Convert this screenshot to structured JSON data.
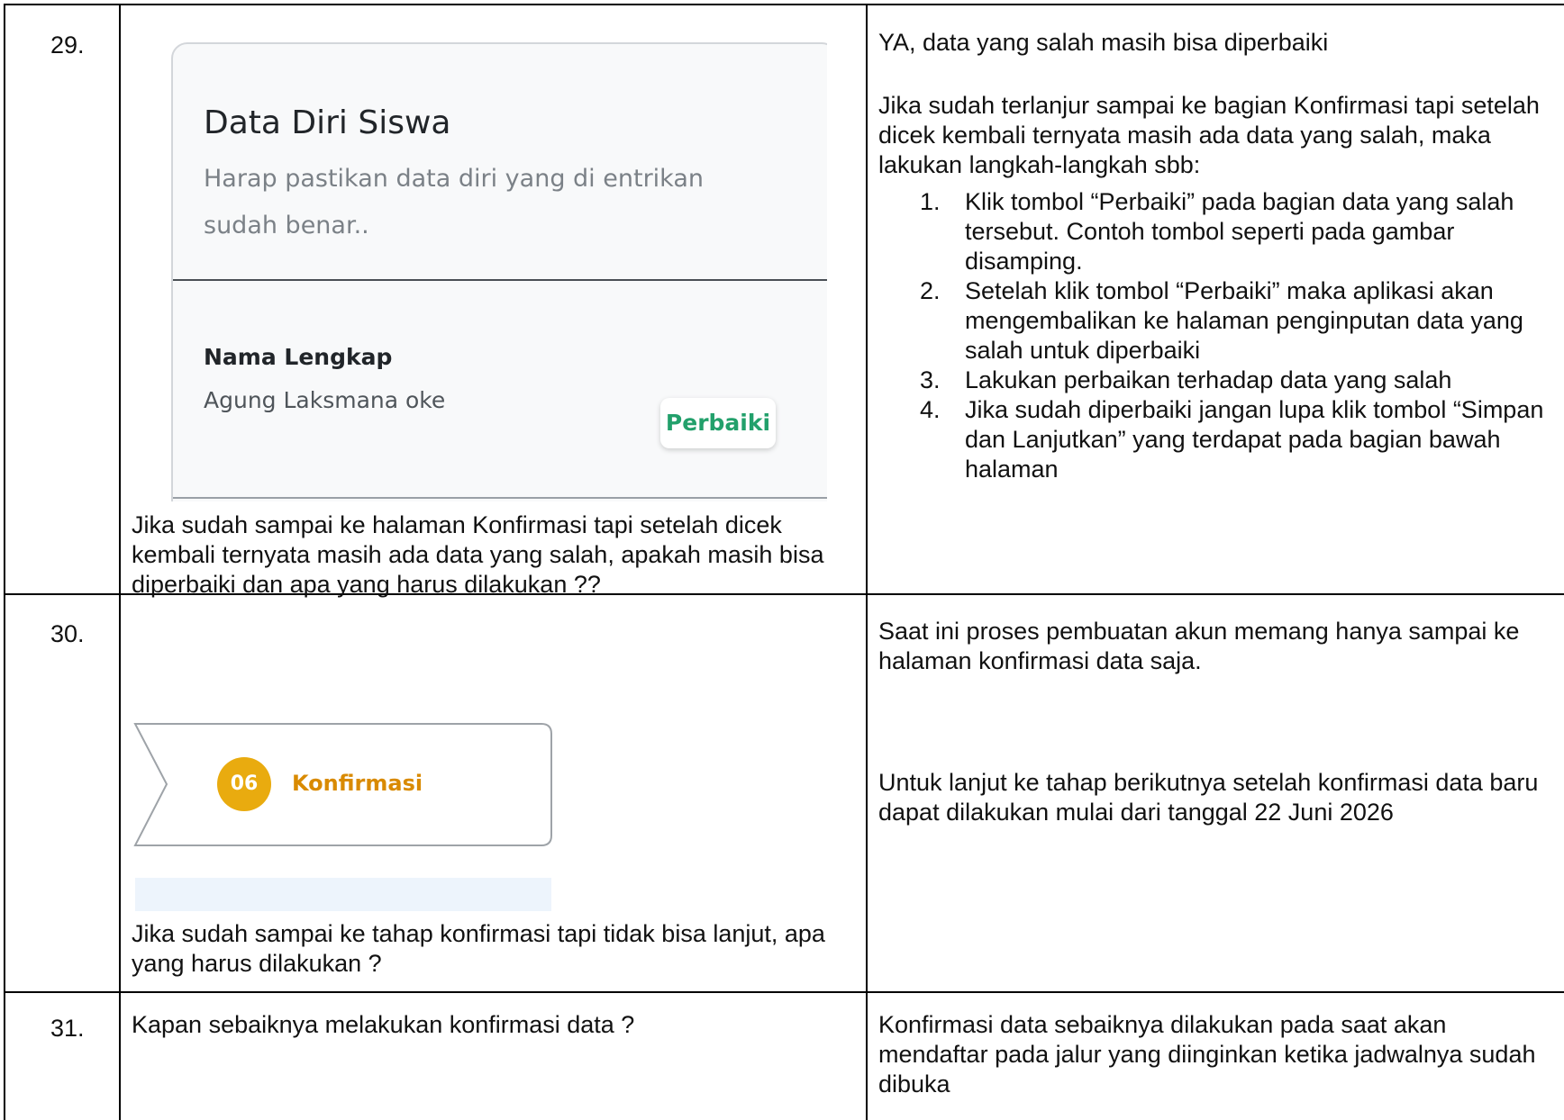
{
  "rows": [
    {
      "number": "29.",
      "screenshot": {
        "card_title": "Data Diri Siswa",
        "card_subtitle": "Harap pastikan data diri yang di entrikan sudah benar..",
        "field_label": "Nama Lengkap",
        "field_value": "Agung Laksmana oke",
        "fix_button": "Perbaiki"
      },
      "question": "Jika sudah sampai ke halaman Konfirmasi tapi setelah dicek kembali ternyata masih ada data yang salah, apakah masih bisa diperbaiki dan apa yang harus dilakukan ??",
      "answer_title": "YA, data yang salah masih bisa diperbaiki",
      "answer_intro": "Jika sudah terlanjur sampai ke bagian Konfirmasi tapi setelah dicek kembali ternyata masih ada data yang salah, maka lakukan langkah-langkah sbb:",
      "steps": [
        {
          "n": "1.",
          "text": "Klik tombol “Perbaiki” pada bagian data yang salah tersebut. Contoh tombol seperti pada gambar disamping."
        },
        {
          "n": "2.",
          "text": "Setelah klik tombol “Perbaiki” maka aplikasi akan mengembalikan ke halaman penginputan data yang salah untuk diperbaiki"
        },
        {
          "n": "3.",
          "text": "Lakukan perbaikan terhadap data yang salah"
        },
        {
          "n": "4.",
          "text": "Jika sudah diperbaiki jangan lupa klik tombol “Simpan dan Lanjutkan” yang terdapat pada bagian bawah halaman"
        }
      ]
    },
    {
      "number": "30.",
      "screenshot": {
        "step_number": "06",
        "step_label": "Konfirmasi"
      },
      "question": "Jika sudah sampai ke tahap konfirmasi tapi tidak bisa lanjut, apa yang harus dilakukan ?",
      "answer_p1": "Saat ini proses pembuatan akun memang hanya sampai ke halaman konfirmasi data saja.",
      "answer_p2": "Untuk lanjut ke tahap berikutnya setelah konfirmasi data baru dapat dilakukan mulai dari tanggal 22 Juni 2026"
    },
    {
      "number": "31.",
      "question": "Kapan sebaiknya melakukan konfirmasi data ?",
      "answer": "Konfirmasi data sebaiknya dilakukan pada saat akan mendaftar pada jalur yang diinginkan ketika jadwalnya sudah dibuka"
    }
  ]
}
